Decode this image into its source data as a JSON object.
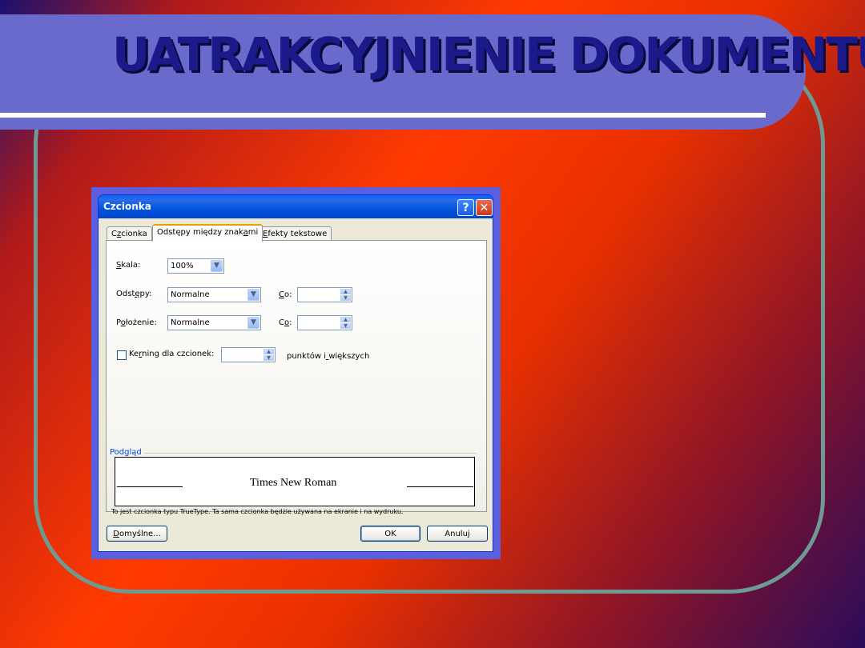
{
  "slide": {
    "title": "UATRAKCYJNIENIE DOKUMENTU"
  },
  "dialog": {
    "title": "Czcionka",
    "tabs": [
      {
        "label": "Czcionka",
        "hotkey_index": 1
      },
      {
        "label": "Odstępy między znakami",
        "hotkey_index": 19
      },
      {
        "label": "Efekty tekstowe",
        "hotkey_index": 0
      }
    ],
    "active_tab": 1,
    "fields": {
      "skala_label": "Skala:",
      "skala_hotkey_index": 0,
      "skala_value": "100%",
      "odstepy_label": "Odstępy:",
      "odstepy_hotkey_index": 4,
      "odstepy_value": "Normalne",
      "co1_label": "Co:",
      "co1_hotkey_index": 0,
      "co1_value": "",
      "polozenie_label": "Położenie:",
      "polozenie_hotkey_index": 1,
      "polozenie_value": "Normalne",
      "co2_label": "Co:",
      "co2_hotkey_index": 1,
      "co2_value": "",
      "kerning_label": "Kerning dla czcionek:",
      "kerning_hotkey_index": 2,
      "kerning_checked": false,
      "kerning_value": "",
      "kerning_suffix": "punktów i większych",
      "kerning_suffix_hotkey_index": 9
    },
    "preview": {
      "legend": "Podgląd",
      "sample_text": "Times New Roman",
      "footnote": "To jest czcionka typu TrueType. Ta sama czcionka będzie używana na ekranie i na wydruku."
    },
    "buttons": {
      "default_label": "Domyślne...",
      "default_hotkey_index": 0,
      "ok_label": "OK",
      "cancel_label": "Anuluj"
    }
  },
  "icons": {
    "help": "question-mark-icon",
    "close": "close-x-icon"
  }
}
